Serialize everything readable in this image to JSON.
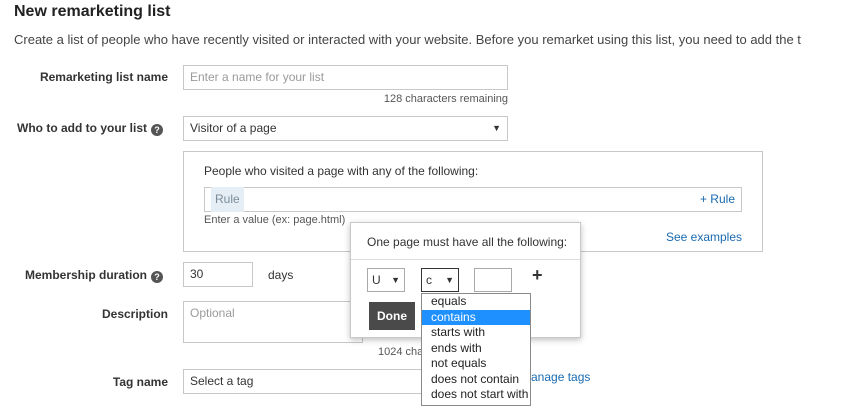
{
  "header": {
    "title": "New remarketing list",
    "description": "Create a list of people who have recently visited or interacted with your website. Before you remarket using this list, you need to add the t"
  },
  "form": {
    "name_label": "Remarketing list name",
    "name_placeholder": "Enter a name for your list",
    "name_remaining": "128 characters remaining",
    "who_label": "Who to add to your list",
    "who_value": "Visitor of a page",
    "rule_panel_heading": "People who visited a page with any of the following:",
    "rule_chip": "Rule",
    "add_rule_link": "+ Rule",
    "rule_hint": "Enter a value (ex: page.html)",
    "see_examples_link": "See examples",
    "duration_label": "Membership duration",
    "duration_value": "30",
    "duration_unit": "days",
    "description_label": "Description",
    "description_placeholder": "Optional",
    "description_remaining": "1024 chara",
    "tag_label": "Tag name",
    "tag_value": "Select a tag",
    "manage_tags_link": "anage tags"
  },
  "popup": {
    "heading": "One page must have all the following:",
    "field_select": "U",
    "operator_select": "c",
    "add_icon": "+",
    "done_label": "Done"
  },
  "operator_dropdown": {
    "options": [
      "equals",
      "contains",
      "starts with",
      "ends with",
      "not equals",
      "does not contain",
      "does not start with"
    ],
    "selected": "contains"
  },
  "icons": {
    "help": "help-question-icon",
    "caret": "caret-down-icon",
    "plus": "plus-icon"
  },
  "colors": {
    "link": "#1a6ab0",
    "selected": "#1e90ff",
    "done_button": "#4a4a4a"
  }
}
